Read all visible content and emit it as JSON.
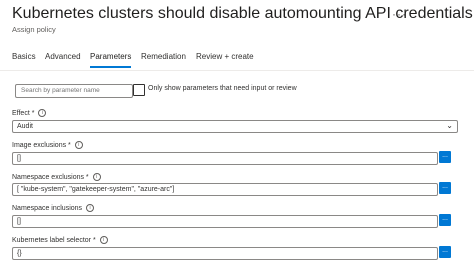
{
  "header": {
    "title": "Kubernetes clusters should disable automounting API credentials",
    "more_icon": "ellipsis-icon",
    "subtitle": "Assign policy"
  },
  "tabs": [
    "Basics",
    "Advanced",
    "Parameters",
    "Remediation",
    "Review + create"
  ],
  "active_tab": "Parameters",
  "toolbar": {
    "search_placeholder": "Search by parameter name",
    "checkbox_label": "Only show parameters that need input or review",
    "checkbox_checked": false
  },
  "params": {
    "effect": {
      "label": "Effect *",
      "value": "Audit"
    },
    "image_exclusions": {
      "label": "Image exclusions *",
      "value": "[]",
      "button": "..."
    },
    "namespace_exclusions": {
      "label": "Namespace exclusions *",
      "value": "[ \"kube-system\", \"gatekeeper-system\", \"azure-arc\"]",
      "button": "..."
    },
    "namespace_inclusions": {
      "label": "Namespace inclusions",
      "value": "[]",
      "button": "..."
    },
    "label_selector": {
      "label": "Kubernetes label selector *",
      "value": "{}",
      "button": "..."
    }
  },
  "colors": {
    "accent": "#0078d4",
    "text": "#323130",
    "border": "#8a8886"
  }
}
